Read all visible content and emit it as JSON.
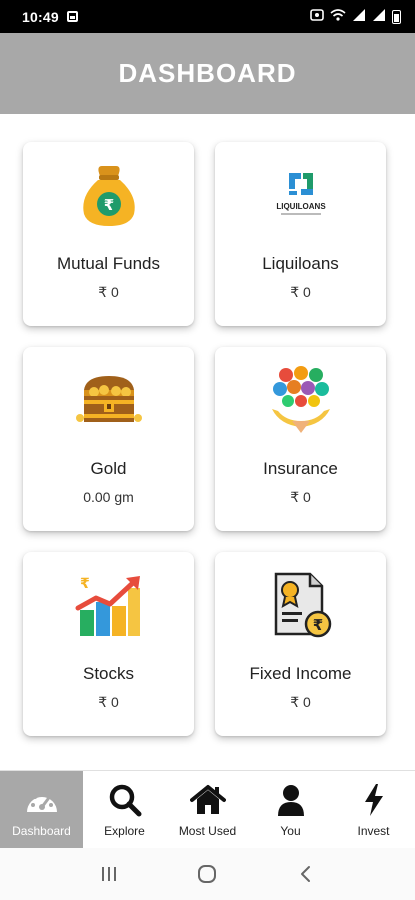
{
  "status": {
    "time": "10:49"
  },
  "header": {
    "title": "DASHBOARD"
  },
  "cards": [
    {
      "name": "Mutual Funds",
      "value": "₹ 0",
      "icon": "money-bag-icon"
    },
    {
      "name": "Liquiloans",
      "value": "₹ 0",
      "icon": "liquiloans-logo"
    },
    {
      "name": "Gold",
      "value": "0.00 gm",
      "icon": "treasure-chest-icon"
    },
    {
      "name": "Insurance",
      "value": "₹ 0",
      "icon": "insurance-hands-icon"
    },
    {
      "name": "Stocks",
      "value": "₹ 0",
      "icon": "growth-chart-icon"
    },
    {
      "name": "Fixed Income",
      "value": "₹ 0",
      "icon": "certificate-rupee-icon"
    }
  ],
  "logo_text": "LIQUILOANS",
  "nav": [
    {
      "label": "Dashboard",
      "icon": "speedometer-icon",
      "active": true
    },
    {
      "label": "Explore",
      "icon": "search-icon",
      "active": false
    },
    {
      "label": "Most Used",
      "icon": "home-icon",
      "active": false
    },
    {
      "label": "You",
      "icon": "user-icon",
      "active": false
    },
    {
      "label": "Invest",
      "icon": "lightning-icon",
      "active": false
    }
  ],
  "colors": {
    "header": "#a8a8a8",
    "active_tab": "#a8a8a8",
    "gold": "#f5b324"
  }
}
